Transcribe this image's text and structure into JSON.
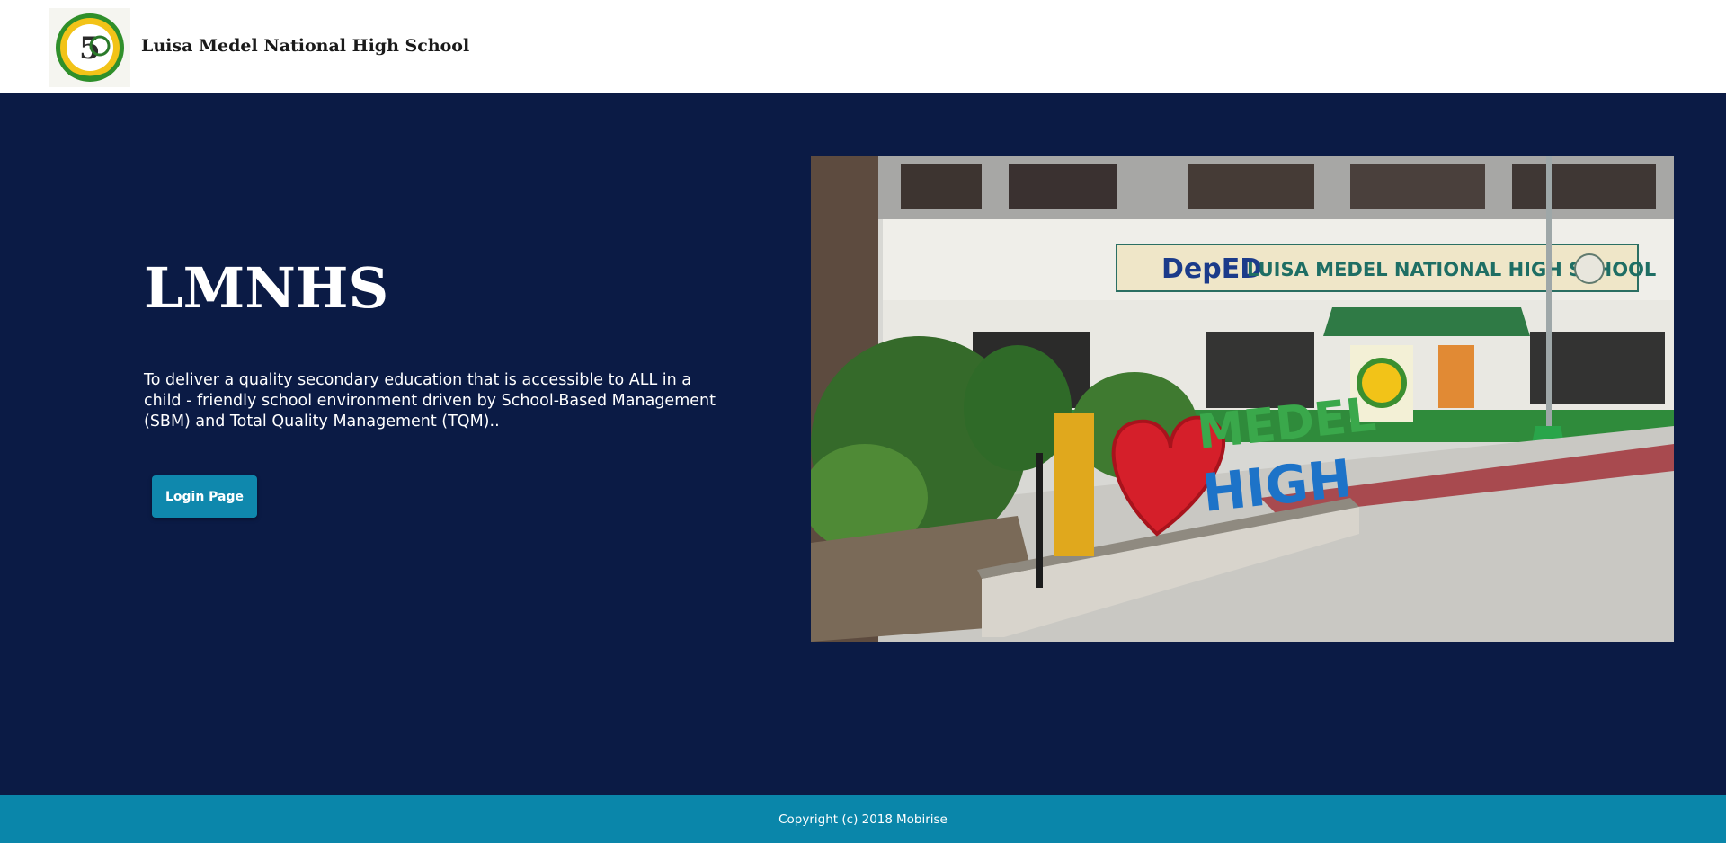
{
  "navbar": {
    "brand_name": "Luisa Medel National High School",
    "logo_icon": "school-seal-50th-anniversary"
  },
  "hero": {
    "title": "LMNHS",
    "mission_text": "To deliver a quality secondary education that is accessible to ALL in a child - friendly school environment driven by School-Based Management (SBM) and Total Quality Management (TQM)..",
    "login_button": "Login Page",
    "photo": {
      "banner_deped": "DepED",
      "banner_school": "LUISA MEDEL NATIONAL HIGH SCHOOL",
      "sign_line1": "MEDEL",
      "sign_line2": "HIGH"
    }
  },
  "footer": {
    "copyright": "Copyright (c) 2018",
    "brand_link": "Mobirise"
  },
  "colors": {
    "hero_background": "#0b1b45",
    "accent": "#0f88ad",
    "footer_background": "#0a86aa",
    "navbar_background": "#ffffff"
  }
}
